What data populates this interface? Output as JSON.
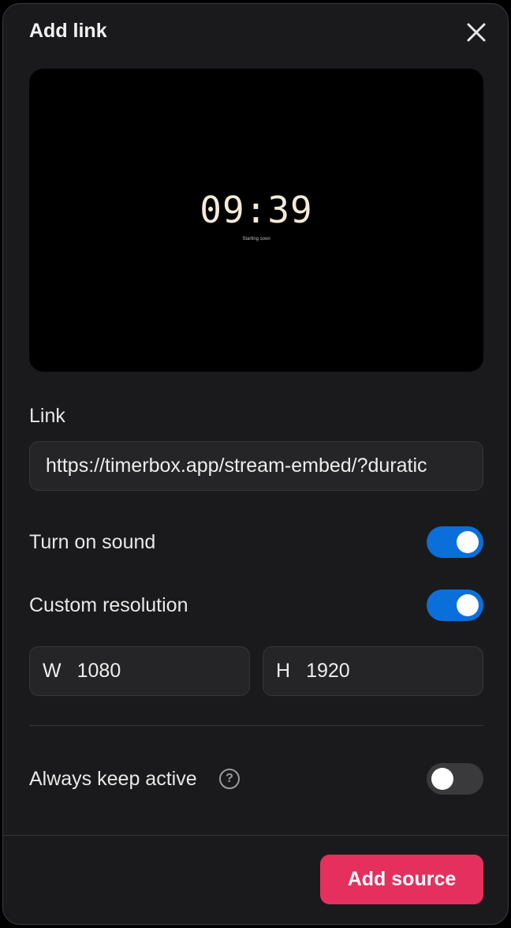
{
  "dialog": {
    "title": "Add link",
    "close_icon": "close-icon"
  },
  "preview": {
    "timer_text": "09:39",
    "subtitle": "Starting soon"
  },
  "link": {
    "label": "Link",
    "value": "https://timerbox.app/stream-embed/?duratic"
  },
  "sound": {
    "label": "Turn on sound",
    "enabled": true
  },
  "resolution": {
    "label": "Custom resolution",
    "enabled": true,
    "width_prefix": "W",
    "width_value": "1080",
    "height_prefix": "H",
    "height_value": "1920"
  },
  "keep_active": {
    "label": "Always keep active",
    "help_icon": "question-circle-icon",
    "help_glyph": "?",
    "enabled": false
  },
  "footer": {
    "add_label": "Add source"
  },
  "colors": {
    "accent_blue": "#0a6fd9",
    "primary_button": "#e5305e",
    "background": "#1a1a1c"
  }
}
